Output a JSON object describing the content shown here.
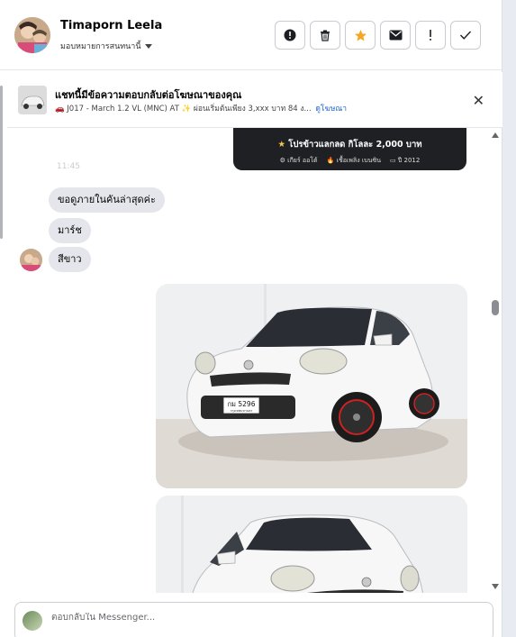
{
  "header": {
    "name": "Timaporn Leela",
    "assign_label": "มอบหมายการสนทนานี้"
  },
  "ad_context": {
    "title": "แชทนี้มีข้อความตอบกลับต่อโฆษณาของคุณ",
    "subtitle": "🚗 J017 - March 1.2 VL (MNC) AT ✨ ผ่อนเริ่มต้นเพียง 3,xxx บาท 84 ง...",
    "link": "ดูโฆษณา"
  },
  "promo_card": {
    "offer": "โปรข้าวแลกลด กิโลละ 2,000 บาท",
    "meta": [
      "เกียร์ ออโต้",
      "เชื้อเพลิง เบนซิน",
      "ปี 2012"
    ]
  },
  "messages": [
    {
      "text": "ขอดูภายในคันล่าสุดค่ะ"
    },
    {
      "text": "มาร์ช"
    },
    {
      "text": "สีขาว"
    }
  ],
  "faded_text": "11:45",
  "photo": {
    "plate_top": "กม 5296",
    "plate_bottom": "กรุงเทพมหานคร"
  },
  "composer": {
    "placeholder": "ตอบกลับใน Messenger..."
  },
  "colors": {
    "link": "#1763cf",
    "bubble": "#e4e6eb",
    "star": "#f2c94c",
    "card": "#1f2024"
  }
}
